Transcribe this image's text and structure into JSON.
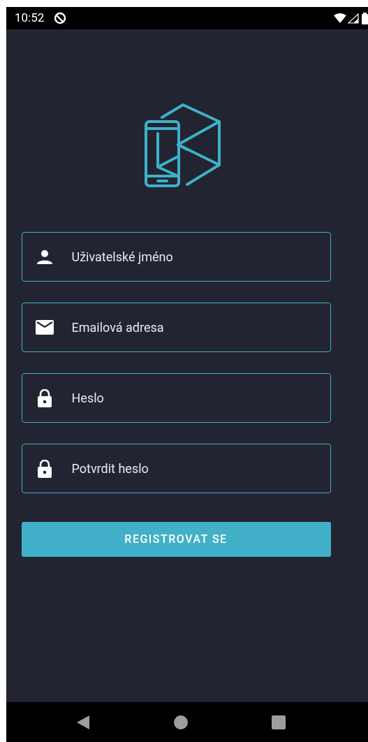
{
  "status_bar": {
    "time": "10:52"
  },
  "fields": [
    {
      "kind": "username",
      "placeholder": "Uživatelské jméno"
    },
    {
      "kind": "email",
      "placeholder": "Emailová adresa"
    },
    {
      "kind": "password",
      "placeholder": "Heslo"
    },
    {
      "kind": "password",
      "placeholder": "Potvrdit heslo"
    }
  ],
  "submit_button": "REGISTROVAT SE"
}
